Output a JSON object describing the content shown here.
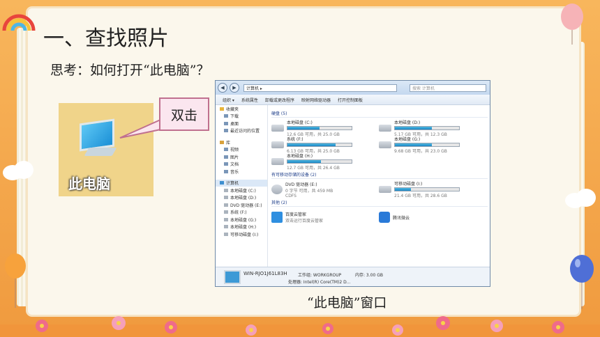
{
  "slide": {
    "title": "一、查找照片",
    "subtitle": "思考：如何打开“此电脑”？",
    "caption": "“此电脑”窗口",
    "callout": "双击",
    "icon_label": "此电脑"
  },
  "explorer": {
    "address": "计算机 ▸",
    "search_placeholder": "搜索 计算机",
    "toolbar": [
      "组织 ▾",
      "系统属性",
      "卸载或更改程序",
      "映射网络驱动器",
      "打开控制面板"
    ],
    "nav": {
      "favorites": "收藏夹",
      "favorite_items": [
        "下载",
        "桌面",
        "最近访问的位置"
      ],
      "libraries": "库",
      "library_items": [
        "视频",
        "图片",
        "文档",
        "音乐"
      ],
      "computer": "计算机",
      "computer_items": [
        "本地磁盘 (C:)",
        "本地磁盘 (D:)",
        "DVD 驱动器 (E:)",
        "系统 (F:)",
        "本地磁盘 (G:)",
        "本地磁盘 (H:)",
        "可移动磁盘 (I:)"
      ]
    },
    "groups": {
      "hdd": "硬盘 (5)",
      "removable": "有可移动存储的设备 (2)",
      "other": "其他 (2)"
    },
    "drives": [
      {
        "name": "本地磁盘 (C:)",
        "space": "12.6 GB 可用，共 25.0 GB",
        "used": 0.5
      },
      {
        "name": "本地磁盘 (D:)",
        "space": "5.17 GB 可用，共 12.3 GB",
        "used": 0.58
      },
      {
        "name": "系统 (F:)",
        "space": "6.13 GB 可用，共 25.0 GB",
        "used": 0.75
      },
      {
        "name": "本地磁盘 (G:)",
        "space": "9.68 GB 可用，共 23.0 GB",
        "used": 0.58
      },
      {
        "name": "本地磁盘 (H:)",
        "space": "12.7 GB 可用，共 26.4 GB",
        "used": 0.52
      }
    ],
    "removable": [
      {
        "name": "DVD 驱动器 (E:)",
        "line2": "0 字节 可用，共 459 MB",
        "line3": "CDFS"
      },
      {
        "name": "可移动磁盘 (I:)",
        "line2": "21.4 GB 可用，共 28.6 GB",
        "used": 0.25
      }
    ],
    "other": [
      {
        "name": "百度云管家",
        "line2": "双击运行百度云管家"
      },
      {
        "name": "腾讯微云",
        "line2": ""
      }
    ],
    "status": {
      "pc_name": "WIN-RJO1J61L83H",
      "workgroup": "工作组: WORKGROUP",
      "memory": "内存: 3.00 GB",
      "cpu": "处理器: Intel(R) Core(TM)2 D..."
    }
  },
  "colors": {
    "background": "#f3a64c",
    "paper": "#fbf7ec",
    "callout_border": "#c0708f",
    "callout_fill": "#fbe6ef"
  }
}
